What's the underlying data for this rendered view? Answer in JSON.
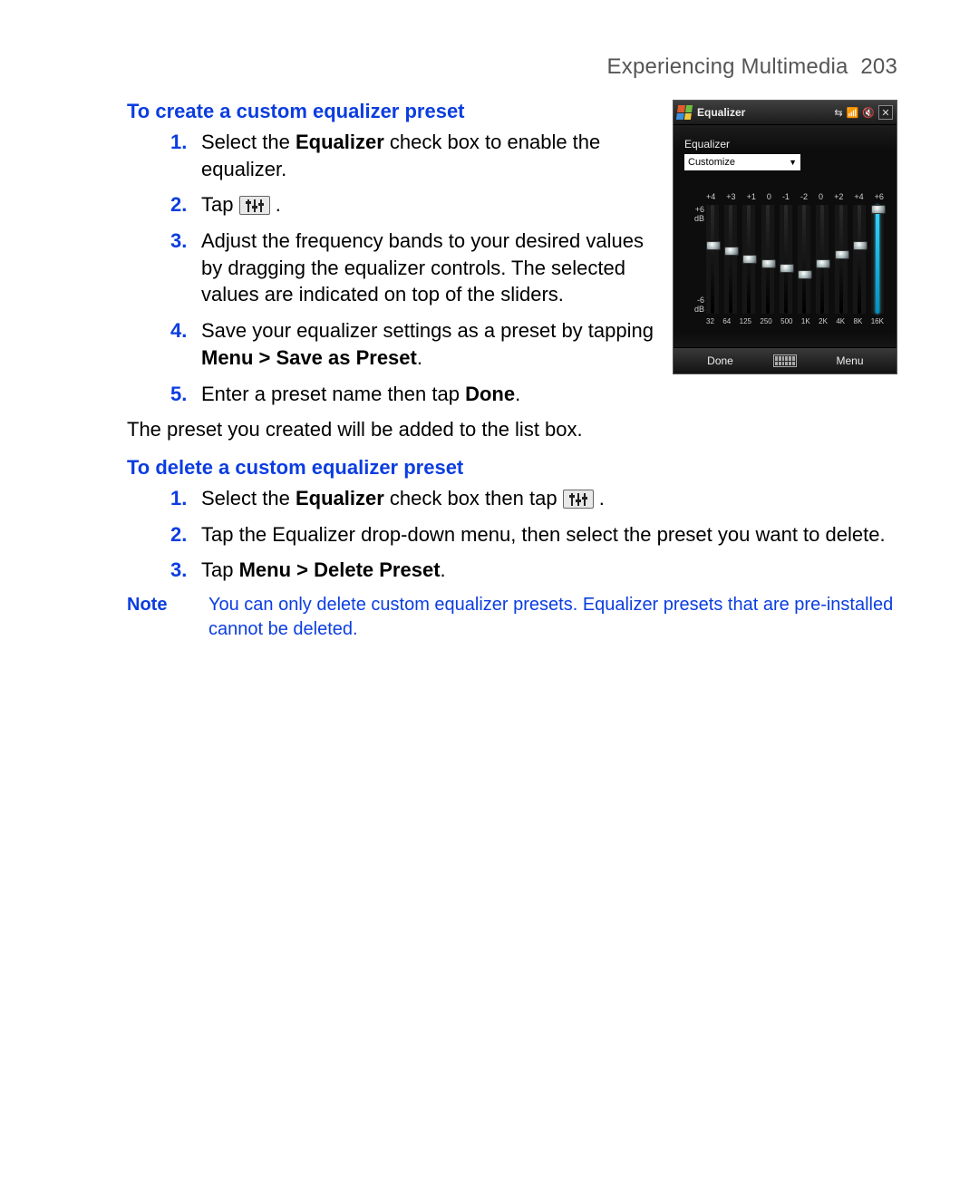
{
  "header": {
    "chapter": "Experiencing Multimedia",
    "page": "203"
  },
  "section1": {
    "title": "To create a custom equalizer preset",
    "steps_num": [
      "1.",
      "2.",
      "3.",
      "4.",
      "5."
    ],
    "s1a": "Select the ",
    "s1b": "Equalizer",
    "s1c": " check box to enable the equalizer.",
    "s2a": "Tap ",
    "s2b": " .",
    "s3": "Adjust the frequency bands to your desired values by dragging the equalizer controls. The selected values are indicated on top of the sliders.",
    "s4a": "Save your equalizer settings as a preset by tapping ",
    "s4b": "Menu > Save as Preset",
    "s4c": ".",
    "s5a": "Enter a preset name then tap ",
    "s5b": "Done",
    "s5c": "."
  },
  "after1": "The preset you created will be added to the list box.",
  "section2": {
    "title": "To delete a custom equalizer preset",
    "steps_num": [
      "1.",
      "2.",
      "3."
    ],
    "s1a": "Select the ",
    "s1b": "Equalizer",
    "s1c": " check box then tap ",
    "s1d": " .",
    "s2": "Tap the Equalizer drop-down menu, then select the preset you want to delete.",
    "s3a": "Tap ",
    "s3b": "Menu > Delete Preset",
    "s3c": "."
  },
  "note": {
    "label": "Note",
    "text": "You can only delete custom equalizer presets. Equalizer presets that are pre-installed cannot be deleted."
  },
  "device": {
    "title": "Equalizer",
    "label": "Equalizer",
    "preset": "Customize",
    "left_top": "+6",
    "left_top2": "dB",
    "left_bot": "-6",
    "left_bot2": "dB",
    "done": "Done",
    "menu": "Menu",
    "values": [
      "+4",
      "+3",
      "+1",
      "0",
      "-1",
      "-2",
      "0",
      "+2",
      "+4",
      "+6"
    ],
    "thumb_pct": [
      33,
      38,
      46,
      50,
      54,
      60,
      50,
      42,
      33,
      0
    ],
    "freqs": [
      "32",
      "64",
      "125",
      "250",
      "500",
      "1K",
      "2K",
      "4K",
      "8K",
      "16K"
    ]
  }
}
